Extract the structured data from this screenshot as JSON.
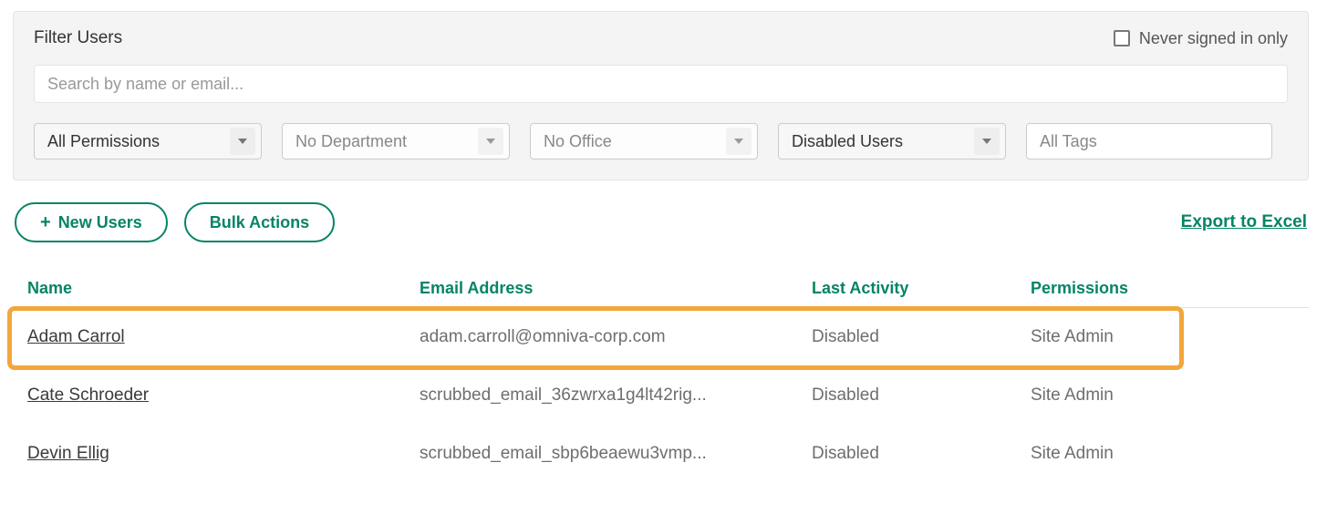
{
  "filter": {
    "title": "Filter Users",
    "never_signed_label": "Never signed in only",
    "search_placeholder": "Search by name or email...",
    "permissions_select": "All Permissions",
    "department_select": "No Department",
    "office_select": "No Office",
    "status_select": "Disabled Users",
    "tags_placeholder": "All Tags"
  },
  "actions": {
    "new_users": "New Users",
    "bulk_actions": "Bulk Actions",
    "export": "Export to Excel"
  },
  "table": {
    "headers": {
      "name": "Name",
      "email": "Email Address",
      "last": "Last Activity",
      "perm": "Permissions"
    },
    "rows": [
      {
        "name": "Adam Carrol",
        "email": "adam.carroll@omniva-corp.com",
        "last": "Disabled",
        "perm": "Site Admin"
      },
      {
        "name": "Cate Schroeder",
        "email": "scrubbed_email_36zwrxa1g4lt42rig...",
        "last": "Disabled",
        "perm": "Site Admin"
      },
      {
        "name": "Devin Ellig",
        "email": "scrubbed_email_sbp6beaewu3vmp...",
        "last": "Disabled",
        "perm": "Site Admin"
      }
    ]
  }
}
